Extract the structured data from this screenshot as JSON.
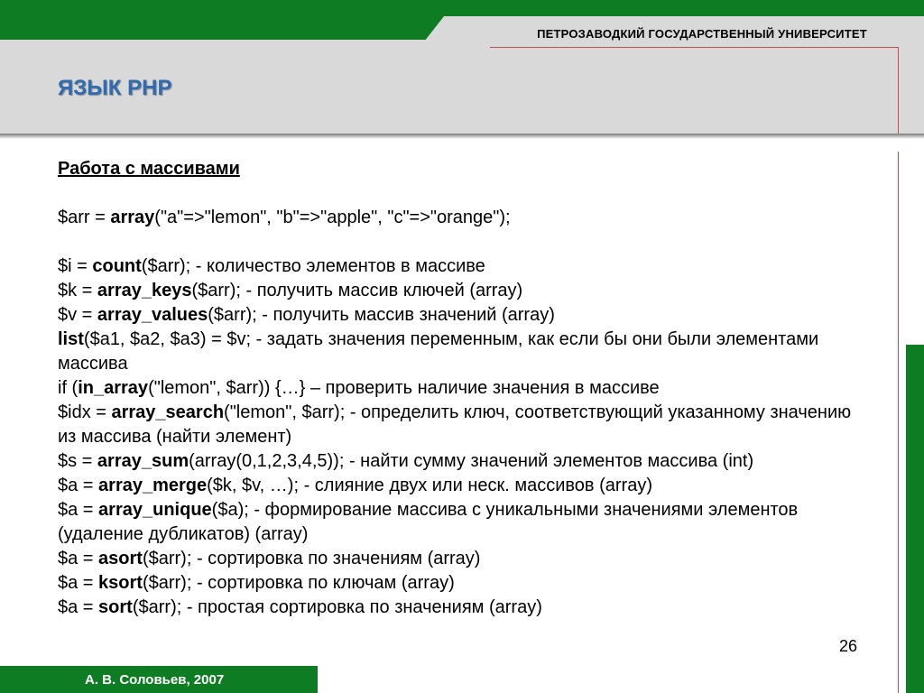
{
  "header": {
    "university": "ПЕТРОЗАВОДКИЙ ГОСУДАРСТВЕННЫЙ УНИВЕРСИТЕТ",
    "slide_title": "ЯЗЫК PHP"
  },
  "content": {
    "heading": "Работа с массивами",
    "lines": [
      {
        "pre": "$arr = ",
        "kw": "array",
        "post": "(\"a\"=>\"lemon\", \"b\"=>\"apple\", \"c\"=>\"orange\");"
      },
      {
        "blank": true
      },
      {
        "pre": "$i = ",
        "kw": "count",
        "post": "($arr); - количество элементов в массиве"
      },
      {
        "pre": "$k = ",
        "kw": "array_keys",
        "post": "($arr); - получить массив ключей (array)"
      },
      {
        "pre": "$v = ",
        "kw": "array_values",
        "post": "($arr); - получить массив значений (array)"
      },
      {
        "pre": "",
        "kw": "list",
        "post": "($a1, $a2, $a3) = $v; - задать значения переменным, как если бы они были элементами массива"
      },
      {
        "pre": "if (",
        "kw": "in_array",
        "post": "(\"lemon\", $arr)) {…} – проверить наличие значения в массиве"
      },
      {
        "pre": "$idx = ",
        "kw": "array_search",
        "post": "(\"lemon\", $arr); - определить ключ, соответствующий указанному значению из массива (найти элемент)"
      },
      {
        "pre": "$s = ",
        "kw": "array_sum",
        "post": "(array(0,1,2,3,4,5)); - найти сумму значений элементов массива (int)"
      },
      {
        "pre": "$a = ",
        "kw": "array_merge",
        "post": "($k, $v, …); - слияние двух или неск. массивов (array)"
      },
      {
        "pre": "$a = ",
        "kw": "array_unique",
        "post": "($a); - формирование массива с уникальными значениями элементов (удаление дубликатов) (array)"
      },
      {
        "pre": "$a = ",
        "kw": "asort",
        "post": "($arr); - сортировка по значениям (array)"
      },
      {
        "pre": "$a = ",
        "kw": "ksort",
        "post": "($arr); - сортировка по ключам (array)"
      },
      {
        "pre": "$a = ",
        "kw": "sort",
        "post": "($arr); - простая сортировка по значениям (array)"
      }
    ]
  },
  "footer": {
    "author": "А. В. Соловьев, 2007",
    "page_number": "26"
  },
  "colors": {
    "green": "#0e7c22",
    "title_blue": "#2e6bb0",
    "accent_red": "#c0504d",
    "title_bar_grey": "#d9d9d9"
  }
}
